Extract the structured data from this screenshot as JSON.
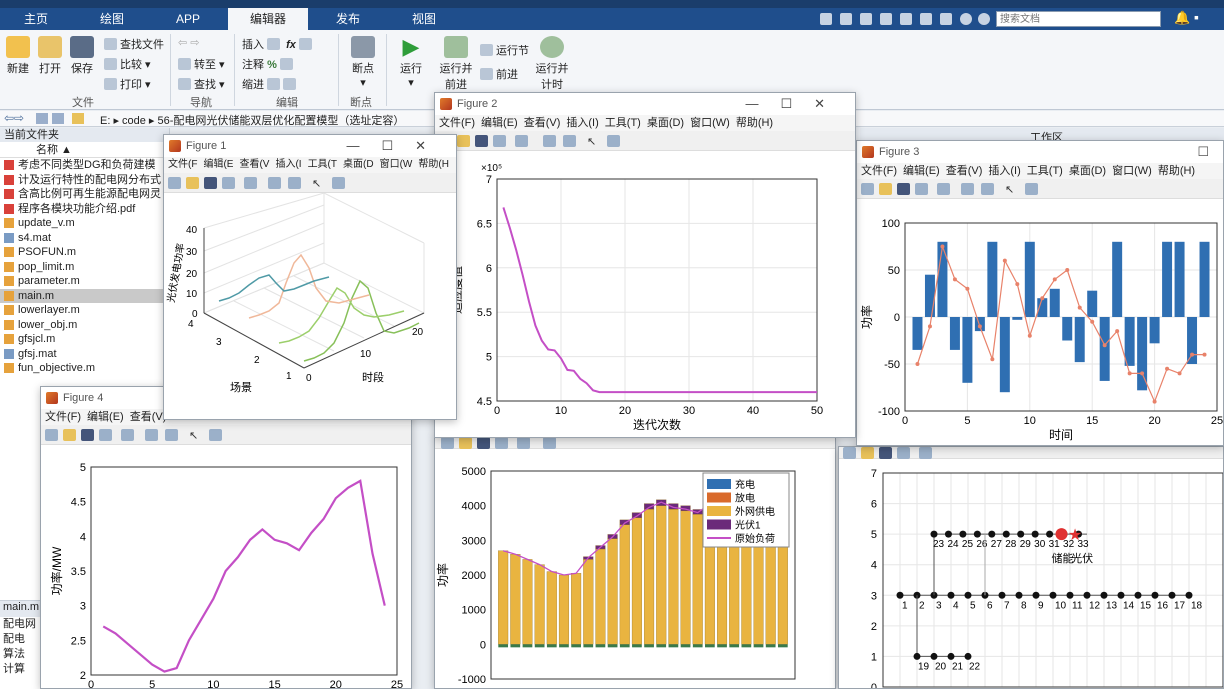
{
  "ribbon": {
    "tabs": [
      "主页",
      "绘图",
      "APP",
      "编辑器",
      "发布",
      "视图"
    ],
    "active_tab": "编辑器",
    "search_placeholder": "搜索文档",
    "buttons": {
      "new": "新建",
      "open": "打开",
      "save": "保存",
      "find_files": "查找文件",
      "compare": "比较",
      "print": "打印",
      "goto": "转至",
      "find": "查找",
      "insert": "插入",
      "comment": "注释",
      "indent": "缩进",
      "breakpoint": "断点",
      "run": "运行",
      "run_advance_1": "运行并",
      "run_advance_2": "前进",
      "run_section": "运行节",
      "advance": "前进",
      "run_time_1": "运行并",
      "run_time_2": "计时"
    },
    "groups": [
      "文件",
      "导航",
      "编辑",
      "断点"
    ]
  },
  "address": {
    "path": "E: ▸ code ▸ 56-配电网光伏储能双层优化配置模型（选址定容）"
  },
  "folder": {
    "title": "当前文件夹",
    "name_header": "名称 ▲",
    "files": [
      "考虑不同类型DG和负荷建模",
      "计及运行特性的配电网分布式",
      "含高比例可再生能源配电网灵",
      "程序各模块功能介绍.pdf",
      "update_v.m",
      "s4.mat",
      "PSOFUN.m",
      "pop_limit.m",
      "parameter.m",
      "main.m",
      "lowerlayer.m",
      "lower_obj.m",
      "gfsjcl.m",
      "gfsj.mat",
      "fun_objective.m"
    ],
    "selected": "main.m",
    "detail_file": "main.m",
    "detail_items": [
      "配电网",
      "配电",
      "算法",
      "计算"
    ]
  },
  "workspace_title": "工作区",
  "fig_menu_full": [
    "文件(F)",
    "编辑(E)",
    "查看(V)",
    "插入(I)",
    "工具(T)",
    "桌面(D)",
    "窗口(W)",
    "帮助(H)"
  ],
  "fig_menu_short": [
    "文件(F",
    "编辑(E",
    "查看(V",
    "插入(I",
    "工具(T",
    "桌面(D",
    "窗口(W",
    "帮助(H"
  ],
  "fig_menu_partial": [
    "文件(F)",
    "编辑(E)",
    "查看(V)"
  ],
  "figures": {
    "f1": "Figure 1",
    "f2": "Figure 2",
    "f3": "Figure 3",
    "f4": "Figure 4"
  },
  "chart_data": [
    {
      "id": "figure2",
      "type": "line",
      "title": "",
      "xlabel": "迭代次数",
      "ylabel": "适应度值",
      "y_exponent": "×10⁵",
      "xlim": [
        0,
        50
      ],
      "ylim": [
        4.5,
        7
      ],
      "xticks": [
        0,
        10,
        20,
        30,
        40,
        50
      ],
      "yticks": [
        4.5,
        5,
        5.5,
        6,
        6.5,
        7
      ],
      "grid": true,
      "color": "#c44fc6",
      "x": [
        1,
        2,
        3,
        4,
        5,
        6,
        7,
        8,
        9,
        10,
        11,
        12,
        13,
        14,
        15,
        16,
        20,
        30,
        40,
        50
      ],
      "y": [
        6.68,
        6.45,
        6.2,
        5.92,
        5.62,
        5.35,
        5.18,
        5.08,
        5.07,
        4.98,
        4.85,
        4.84,
        4.75,
        4.7,
        4.62,
        4.6,
        4.6,
        4.6,
        4.6,
        4.6
      ]
    },
    {
      "id": "figure3",
      "type": "bar",
      "xlabel": "时间",
      "ylabel": "功率",
      "xlim": [
        0,
        25
      ],
      "ylim": [
        -100,
        100
      ],
      "xticks": [
        0,
        5,
        10,
        15,
        20,
        25
      ],
      "yticks": [
        -100,
        -50,
        0,
        50,
        100
      ],
      "grid": true,
      "bar_color": "#2f6fb2",
      "line_color": "#e8826a",
      "x": [
        1,
        2,
        3,
        4,
        5,
        6,
        7,
        8,
        9,
        10,
        11,
        12,
        13,
        14,
        15,
        16,
        17,
        18,
        19,
        20,
        21,
        22,
        23,
        24
      ],
      "bars": [
        -35,
        45,
        80,
        -35,
        -70,
        -15,
        80,
        -80,
        -3,
        80,
        20,
        30,
        -25,
        -48,
        28,
        -68,
        80,
        -52,
        -78,
        -28,
        80,
        80,
        -50,
        80
      ],
      "line": [
        -50,
        -10,
        75,
        40,
        30,
        -10,
        -45,
        60,
        35,
        -20,
        20,
        40,
        50,
        10,
        -5,
        -30,
        -15,
        -60,
        -60,
        -90,
        -55,
        -60,
        -40,
        -40
      ]
    },
    {
      "id": "figure4",
      "type": "line",
      "xlabel": "",
      "ylabel": "功率/MW",
      "xlim": [
        0,
        25
      ],
      "ylim": [
        2,
        5
      ],
      "xticks": [
        0,
        5,
        10,
        15,
        20,
        25
      ],
      "yticks": [
        2,
        2.5,
        3,
        3.5,
        4,
        4.5,
        5
      ],
      "grid": false,
      "color": "#c44fc6",
      "x": [
        1,
        2,
        3,
        4,
        5,
        6,
        7,
        8,
        9,
        10,
        11,
        12,
        13,
        14,
        15,
        16,
        17,
        18,
        19,
        20,
        21,
        22,
        23,
        24
      ],
      "y": [
        2.7,
        2.6,
        2.45,
        2.3,
        2.15,
        2.05,
        2.1,
        2.5,
        2.8,
        3.1,
        3.5,
        3.7,
        3.95,
        4.1,
        3.95,
        3.9,
        3.8,
        4.05,
        4.25,
        4.55,
        4.7,
        4.8,
        3.75,
        3.0
      ]
    },
    {
      "id": "figure5",
      "type": "bar",
      "stacked": true,
      "ylabel": "功率",
      "xlim": [
        0,
        25
      ],
      "ylim": [
        -1000,
        5000
      ],
      "yticks": [
        -1000,
        0,
        1000,
        2000,
        3000,
        4000,
        5000
      ],
      "legend": "top-right",
      "series": [
        {
          "name": "充电",
          "color": "#2f6fb2",
          "values": [
            0,
            0,
            0,
            0,
            0,
            0,
            0,
            0,
            0,
            0,
            0,
            0,
            0,
            0,
            0,
            0,
            0,
            0,
            0,
            0,
            0,
            0,
            0,
            0
          ]
        },
        {
          "name": "放电",
          "color": "#d96a2b",
          "values": [
            0,
            0,
            0,
            0,
            0,
            0,
            0,
            0,
            0,
            0,
            0,
            0,
            0,
            0,
            0,
            0,
            0,
            0,
            0,
            0,
            0,
            0,
            0,
            0
          ]
        },
        {
          "name": "外网供电",
          "color": "#e9b440",
          "values": [
            2700,
            2600,
            2450,
            2300,
            2100,
            2000,
            2050,
            2450,
            2750,
            3050,
            3450,
            3650,
            3900,
            4000,
            3900,
            3850,
            3750,
            3950,
            4150,
            4400,
            4550,
            4600,
            3700,
            2900
          ]
        },
        {
          "name": "光伏1",
          "color": "#6b2a7a",
          "values": [
            0,
            0,
            0,
            0,
            0,
            0,
            0,
            80,
            100,
            120,
            140,
            150,
            160,
            170,
            160,
            150,
            140,
            120,
            100,
            80,
            0,
            0,
            0,
            0
          ]
        },
        {
          "name": "原始负荷",
          "color": "#c44fc6",
          "values": [
            2700,
            2600,
            2450,
            2300,
            2100,
            2000,
            2050,
            2500,
            2800,
            3100,
            3500,
            3700,
            3950,
            4100,
            3950,
            3900,
            3800,
            4050,
            4250,
            4550,
            4700,
            4800,
            3750,
            2950
          ]
        }
      ]
    },
    {
      "id": "figure6",
      "type": "scatter",
      "note_labels": [
        "储能",
        "光伏"
      ],
      "xlim": [
        0,
        20
      ],
      "ylim": [
        0,
        7
      ],
      "yticks": [
        0,
        1,
        2,
        3,
        4,
        5,
        6,
        7
      ],
      "grid": true,
      "main_row": [
        1,
        2,
        3,
        4,
        5,
        6,
        7,
        8,
        9,
        10,
        11,
        12,
        13,
        14,
        15,
        16,
        17,
        18
      ],
      "branch_top": [
        23,
        24,
        25,
        26,
        27,
        28,
        29,
        30,
        31,
        32,
        33
      ],
      "branch_bottom": [
        19,
        20,
        21,
        22
      ]
    }
  ]
}
